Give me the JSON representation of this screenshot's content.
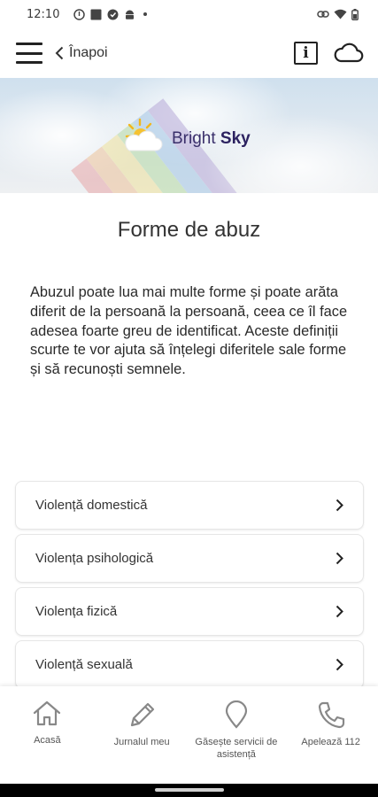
{
  "status_bar": {
    "time": "12:10"
  },
  "appbar": {
    "back_label": "Înapoi",
    "info_glyph": "i"
  },
  "banner": {
    "logo_word1": "Bright",
    "logo_word2": "Sky"
  },
  "page": {
    "title": "Forme de abuz",
    "intro": "Abuzul poate lua mai multe forme și poate arăta diferit de la persoană la persoană, ceea ce îl face adesea foarte greu de identificat. Aceste definiții scurte te vor ajuta să înțelegi diferitele sale forme și să recunoști semnele."
  },
  "abuse_types": [
    {
      "label": "Violență domestică"
    },
    {
      "label": "Violența psihologică"
    },
    {
      "label": "Violența fizică"
    },
    {
      "label": "Violență sexuală"
    }
  ],
  "bottom_nav": [
    {
      "label": "Acasă",
      "icon": "home-icon"
    },
    {
      "label": "Jurnalul meu",
      "icon": "pencil-icon"
    },
    {
      "label": "Găsește servicii de asistență",
      "icon": "map-pin-icon"
    },
    {
      "label": "Apelează 112",
      "icon": "phone-icon"
    }
  ],
  "colors": {
    "logo_text": "#2c2260",
    "text": "#2a2a2a",
    "icon_gray": "#888888"
  }
}
